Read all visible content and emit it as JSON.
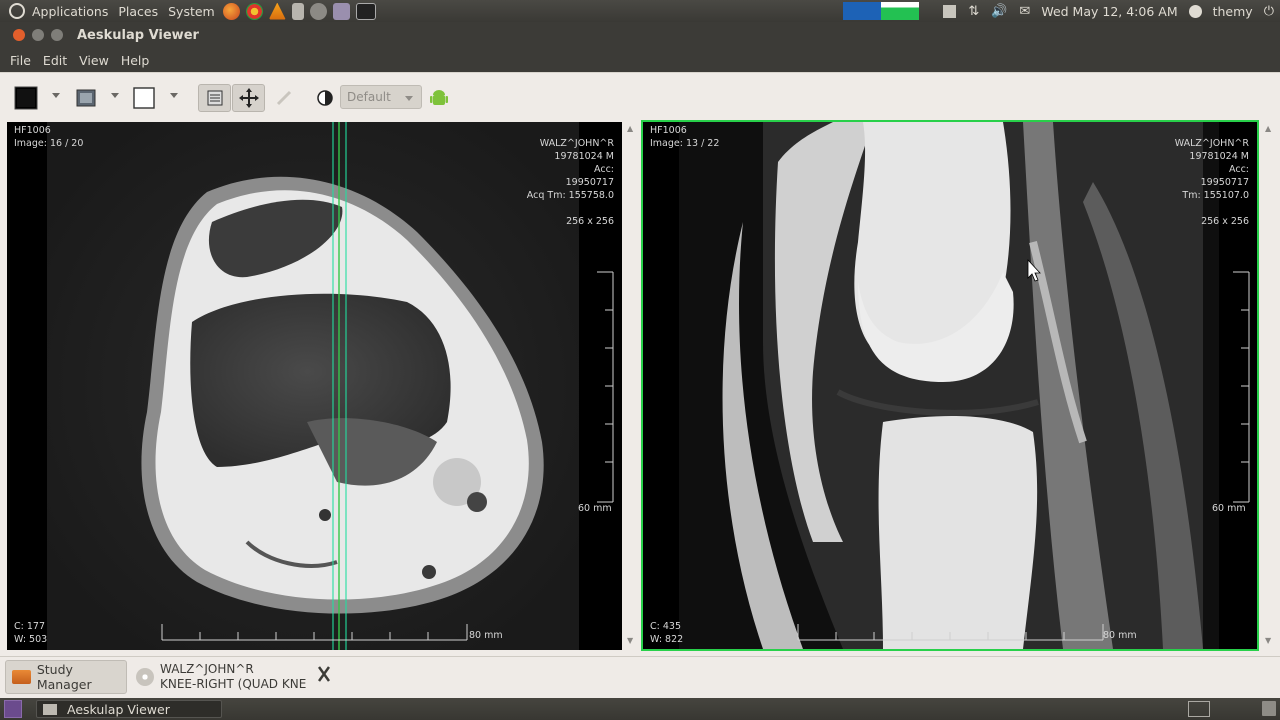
{
  "top_panel": {
    "menus": [
      "Applications",
      "Places",
      "System"
    ],
    "datetime": "Wed May 12,  4:06 AM",
    "user": "themy"
  },
  "window": {
    "title": "Aeskulap Viewer"
  },
  "menubar": {
    "items": [
      "File",
      "Edit",
      "View",
      "Help"
    ]
  },
  "toolbar": {
    "preset_label": "Default"
  },
  "viewports": [
    {
      "series": "HF1006",
      "image": "Image: 16 / 20",
      "patient": "WALZ^JOHN^R",
      "dob_sex": "19781024 M",
      "acc": "Acc:",
      "acq_date": "19950717",
      "acq_time": "Acq Tm: 155758.0",
      "matrix": "256 x 256",
      "scale": "60 mm",
      "scale_h": "80 mm",
      "center": "C: 177",
      "width": "W: 503"
    },
    {
      "series": "HF1006",
      "image": "Image: 13 / 22",
      "patient": "WALZ^JOHN^R",
      "dob_sex": "19781024 M",
      "acc": "Acc:",
      "acq_date": "19950717",
      "acq_time": "Tm: 155107.0",
      "matrix": "256 x 256",
      "scale": "60 mm",
      "scale_h": "80 mm",
      "center": "C: 435",
      "width": "W: 822"
    }
  ],
  "study_bar": {
    "study_manager": "Study Manager",
    "study_patient": "WALZ^JOHN^R",
    "study_desc": "KNEE-RIGHT (QUAD KNE"
  },
  "bottom_panel": {
    "window_button": "Aeskulap Viewer"
  }
}
